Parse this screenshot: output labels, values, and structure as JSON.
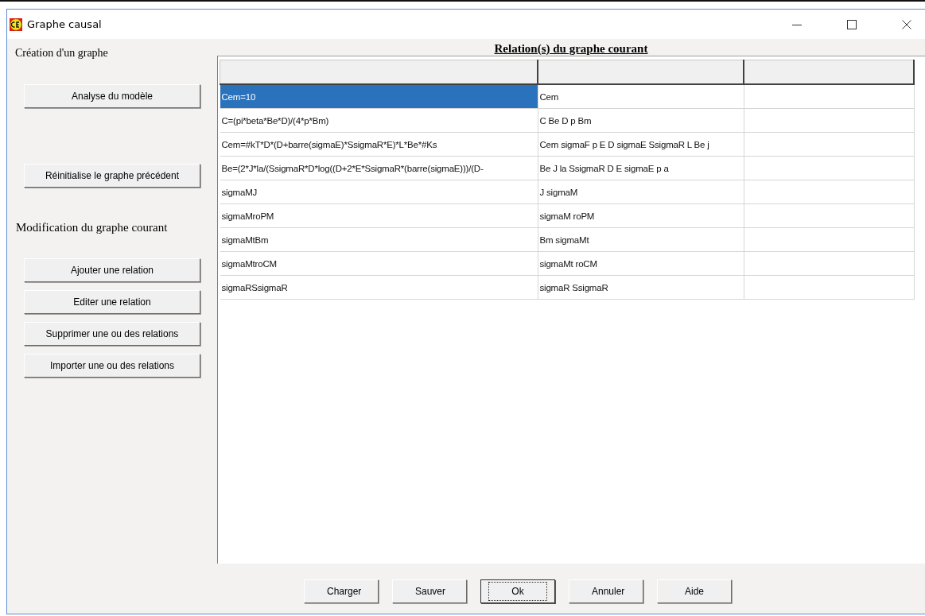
{
  "window": {
    "title": "Graphe causal"
  },
  "creation": {
    "heading": "Création d'un graphe",
    "buttons": [
      "Analyse du modèle",
      "Réinitialise le graphe précédent"
    ]
  },
  "modification": {
    "heading": "Modification du graphe courant",
    "buttons": [
      "Ajouter une relation",
      "Editer une relation",
      "Supprimer une ou des relations",
      "Importer une ou des relations"
    ]
  },
  "table": {
    "title": "Relation(s) du graphe courant",
    "rows": [
      {
        "cells": [
          "Cem=10",
          "Cem"
        ],
        "selected": true
      },
      {
        "cells": [
          "C=(pi*beta*Be*D)/(4*p*Bm)",
          "C Be D p Bm"
        ],
        "selected": false
      },
      {
        "cells": [
          "Cem=#kT*D*(D+barre(sigmaE)*SsigmaR*E)*L*Be*#Ks",
          "Cem sigmaF p E D sigmaE SsigmaR L Be j"
        ],
        "selected": false
      },
      {
        "cells": [
          "Be=(2*J*la/(SsigmaR*D*log((D+2*E*SsigmaR*(barre(sigmaE)))/(D-",
          "Be J la SsigmaR D E sigmaE p a"
        ],
        "selected": false
      },
      {
        "cells": [
          "sigmaMJ",
          "J sigmaM"
        ],
        "selected": false
      },
      {
        "cells": [
          "sigmaMroPM",
          "sigmaM roPM"
        ],
        "selected": false
      },
      {
        "cells": [
          "sigmaMtBm",
          "Bm sigmaMt"
        ],
        "selected": false
      },
      {
        "cells": [
          "sigmaMtroCM",
          "sigmaMt roCM"
        ],
        "selected": false
      },
      {
        "cells": [
          "sigmaRSsigmaR",
          "sigmaR SsigmaR"
        ],
        "selected": false
      }
    ]
  },
  "footer": {
    "buttons": [
      {
        "label": "Charger",
        "default": false
      },
      {
        "label": "Sauver",
        "default": false
      },
      {
        "label": "Ok",
        "default": true
      },
      {
        "label": "Annuler",
        "default": false
      },
      {
        "label": "Aide",
        "default": false
      }
    ]
  }
}
